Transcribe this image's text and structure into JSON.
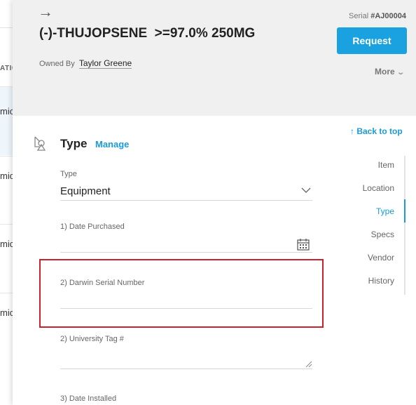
{
  "background_list": {
    "column_header": "ATIO",
    "rows": [
      {
        "text": "mic"
      },
      {
        "text": "mic"
      },
      {
        "text": "mic"
      },
      {
        "text": "mic"
      }
    ]
  },
  "header": {
    "back_icon": "arrow-right-icon",
    "title": "(-)-THUJOPSENE  >=97.0% 250MG",
    "owned_by_label": "Owned By",
    "owner_name": "Taylor Greene",
    "serial_label": "Serial",
    "serial_value": "#AJ00004",
    "request_button": "Request",
    "more_label": "More"
  },
  "section": {
    "title": "Type",
    "manage_link": "Manage",
    "icon": "type-shapes-icon"
  },
  "fields": {
    "type_label": "Type",
    "type_value": "Equipment",
    "date_purchased_label": "1) Date Purchased",
    "date_purchased_value": "",
    "darwin_serial_label": "2) Darwin Serial Number",
    "darwin_serial_value": "",
    "university_tag_label": "2) University Tag #",
    "university_tag_value": "",
    "date_installed_label": "3) Date Installed"
  },
  "nav": {
    "back_to_top": "Back to top",
    "items": [
      {
        "label": "Item"
      },
      {
        "label": "Location"
      },
      {
        "label": "Type"
      },
      {
        "label": "Specs"
      },
      {
        "label": "Vendor"
      },
      {
        "label": "History"
      }
    ],
    "active_item": "Type"
  },
  "colors": {
    "accent": "#1a9bd7",
    "request_button": "#1aa1e0",
    "highlight_border": "#c8222c",
    "header_bg": "#f0f0f0"
  }
}
